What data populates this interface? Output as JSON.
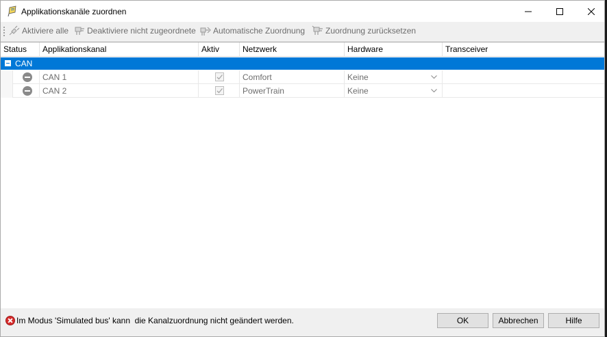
{
  "window": {
    "title": "Applikationskanäle zuordnen",
    "controls": [
      "minimize",
      "maximize",
      "close"
    ]
  },
  "toolbar": {
    "activate_all": "Aktiviere alle",
    "deactivate_unassigned": "Deaktiviere nicht zugeordnete",
    "auto_assign": "Automatische Zuordnung",
    "reset_assign": "Zuordnung zurücksetzen"
  },
  "grid": {
    "columns": [
      "Status",
      "Applikationskanal",
      "Aktiv",
      "Netzwerk",
      "Hardware",
      "Transceiver"
    ],
    "group": {
      "label": "CAN",
      "expanded": true
    },
    "rows": [
      {
        "status": "inactive",
        "channel": "CAN 1",
        "active": true,
        "network": "Comfort",
        "hardware": "Keine",
        "transceiver": ""
      },
      {
        "status": "inactive",
        "channel": "CAN 2",
        "active": true,
        "network": "PowerTrain",
        "hardware": "Keine",
        "transceiver": ""
      }
    ]
  },
  "footer": {
    "message": "Im Modus 'Simulated bus' kann  die Kanalzuordnung nicht geändert werden.",
    "ok": "OK",
    "cancel": "Abbrechen",
    "help": "Hilfe"
  },
  "colors": {
    "selection": "#0078d7",
    "disabled_text": "#6d6d6d",
    "error": "#d62b2b"
  }
}
